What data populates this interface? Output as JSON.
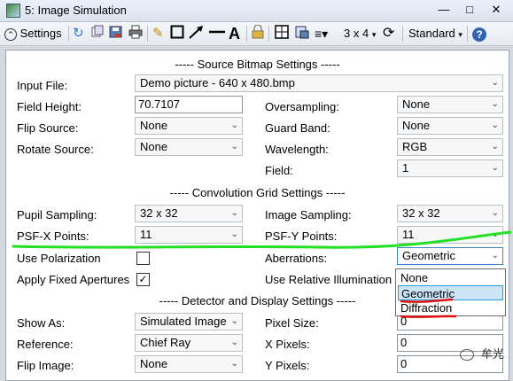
{
  "window": {
    "title": "5: Image Simulation"
  },
  "toolbar": {
    "settings_label": "Settings",
    "layout_label": "3 x 4",
    "standard_label": "Standard",
    "icons": [
      "refresh-icon",
      "copy-icon",
      "save-icon",
      "print-icon",
      "pencil-icon",
      "rectangle-icon",
      "arrow-icon",
      "line-icon",
      "text-icon",
      "lock-icon",
      "window-icon",
      "export-icon",
      "layers-icon",
      "rotate-icon",
      "help-icon"
    ]
  },
  "source": {
    "header": "----- Source Bitmap Settings -----",
    "input_file_label": "Input File:",
    "input_file_value": "Demo picture -  640 x 480.bmp",
    "field_height_label": "Field Height:",
    "field_height_value": "70.7107",
    "oversampling_label": "Oversampling:",
    "oversampling_value": "None",
    "flip_source_label": "Flip Source:",
    "flip_source_value": "None",
    "guard_band_label": "Guard Band:",
    "guard_band_value": "None",
    "rotate_source_label": "Rotate Source:",
    "rotate_source_value": "None",
    "wavelength_label": "Wavelength:",
    "wavelength_value": "RGB",
    "field_label": "Field:",
    "field_value": "1"
  },
  "convolution": {
    "header": "----- Convolution Grid Settings -----",
    "pupil_sampling_label": "Pupil Sampling:",
    "pupil_sampling_value": "32 x 32",
    "image_sampling_label": "Image Sampling:",
    "image_sampling_value": "32 x 32",
    "psf_x_label": "PSF-X Points:",
    "psf_x_value": "11",
    "psf_y_label": "PSF-Y Points:",
    "psf_y_value": "11",
    "use_polarization_label": "Use Polarization",
    "use_polarization_checked": false,
    "aberrations_label": "Aberrations:",
    "aberrations_value": "Geometric",
    "aberrations_options": [
      "None",
      "Geometric",
      "Diffraction"
    ],
    "apply_fixed_apertures_label": "Apply Fixed Apertures",
    "apply_fixed_apertures_check": "✓",
    "use_relative_illumination_label": "Use Relative Illumination"
  },
  "display": {
    "header": "----- Detector and Display Settings -----",
    "show_as_label": "Show As:",
    "show_as_value": "Simulated Image",
    "pixel_size_label": "Pixel Size:",
    "pixel_size_value": "0",
    "reference_label": "Reference:",
    "reference_value": "Chief Ray",
    "x_pixels_label": "X Pixels:",
    "x_pixels_value": "0",
    "flip_image_label": "Flip Image:",
    "flip_image_value": "None",
    "y_pixels_label": "Y Pixels:",
    "y_pixels_value": "0"
  },
  "watermark": "牟光",
  "colors": {
    "annotation_green": "#22e022",
    "annotation_red": "#e01010",
    "accent": "#26a0da"
  }
}
